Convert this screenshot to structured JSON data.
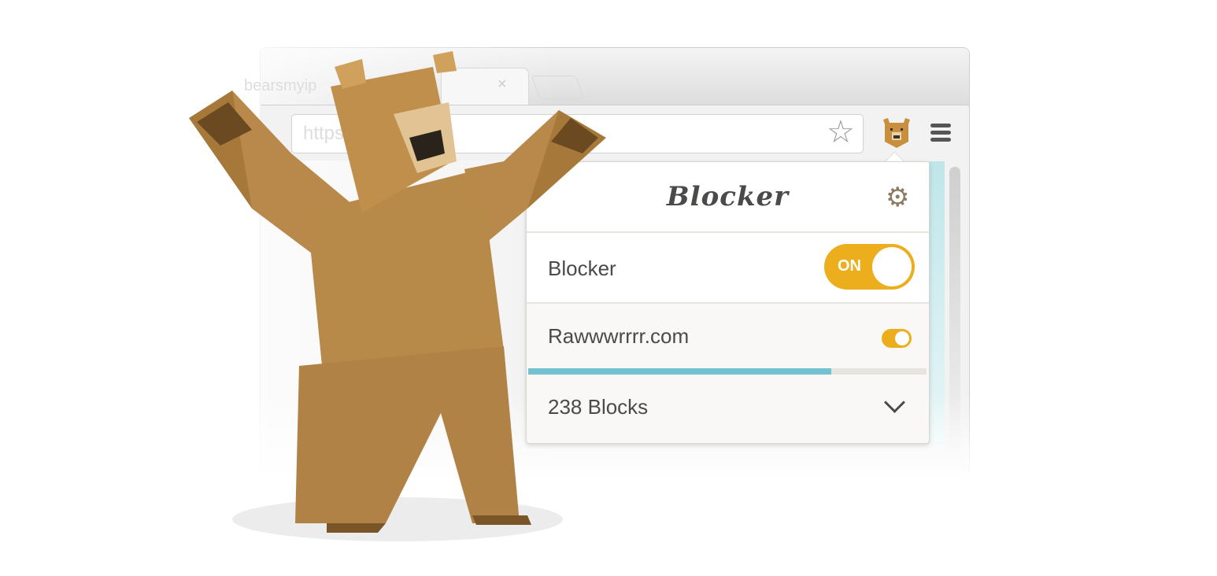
{
  "browser": {
    "tab_title": "bearsmyip",
    "tab_close": "×",
    "address": "https://bearsmyip"
  },
  "popup": {
    "logo": "Blocker",
    "blocker_label": "Blocker",
    "blocker_toggle": "ON",
    "site": "Rawwwrrrr.com",
    "site_enabled": true,
    "progress": 0.76,
    "blocks": "238 Blocks"
  },
  "colors": {
    "accent": "#ecae1c",
    "progress": "#72c2d1",
    "text": "#4a4a48"
  }
}
